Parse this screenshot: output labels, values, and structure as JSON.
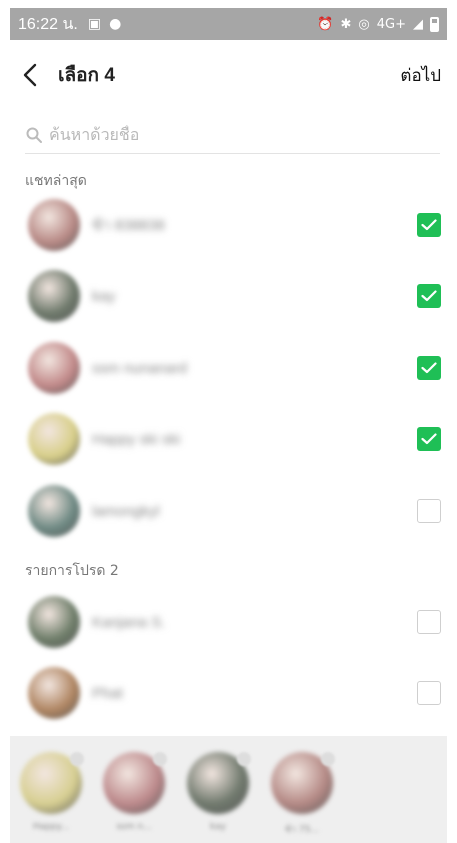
{
  "status_bar": {
    "time": "16:22 น.",
    "network": "4G+"
  },
  "header": {
    "title": "เลือก 4",
    "next_label": "ต่อไป"
  },
  "search": {
    "placeholder": "ค้นหาด้วยชื่อ"
  },
  "sections": {
    "recent_label": "แชทล่าสุด",
    "favorites_label": "รายการโปรด 2"
  },
  "rows": [
    {
      "name": "ซ้า 838838",
      "checked": true,
      "avatar_color": "#b88a86"
    },
    {
      "name": "kay",
      "checked": true,
      "avatar_color": "#6f7a6c"
    },
    {
      "name": "ssm nunanard",
      "checked": true,
      "avatar_color": "#c28a8a"
    },
    {
      "name": "Happy ski ski",
      "checked": true,
      "avatar_color": "#d8cf8a"
    },
    {
      "name": "lamongkyl",
      "checked": false,
      "avatar_color": "#6f8a84"
    },
    {
      "name": "Kanjana S.",
      "checked": false,
      "avatar_color": "#6f7e6a"
    },
    {
      "name": "Phat",
      "checked": false,
      "avatar_color": "#b08663"
    }
  ],
  "selected_tray": [
    {
      "name": "Happy...",
      "avatar_color": "#d7cf92"
    },
    {
      "name": "ssm n...",
      "avatar_color": "#bd8a8c"
    },
    {
      "name": "kay",
      "avatar_color": "#717a6e"
    },
    {
      "name": "ซ้า 75...",
      "avatar_color": "#b58a86"
    }
  ],
  "colors": {
    "accent_check": "#1fbf56",
    "status_bar": "#a6a6a6"
  }
}
